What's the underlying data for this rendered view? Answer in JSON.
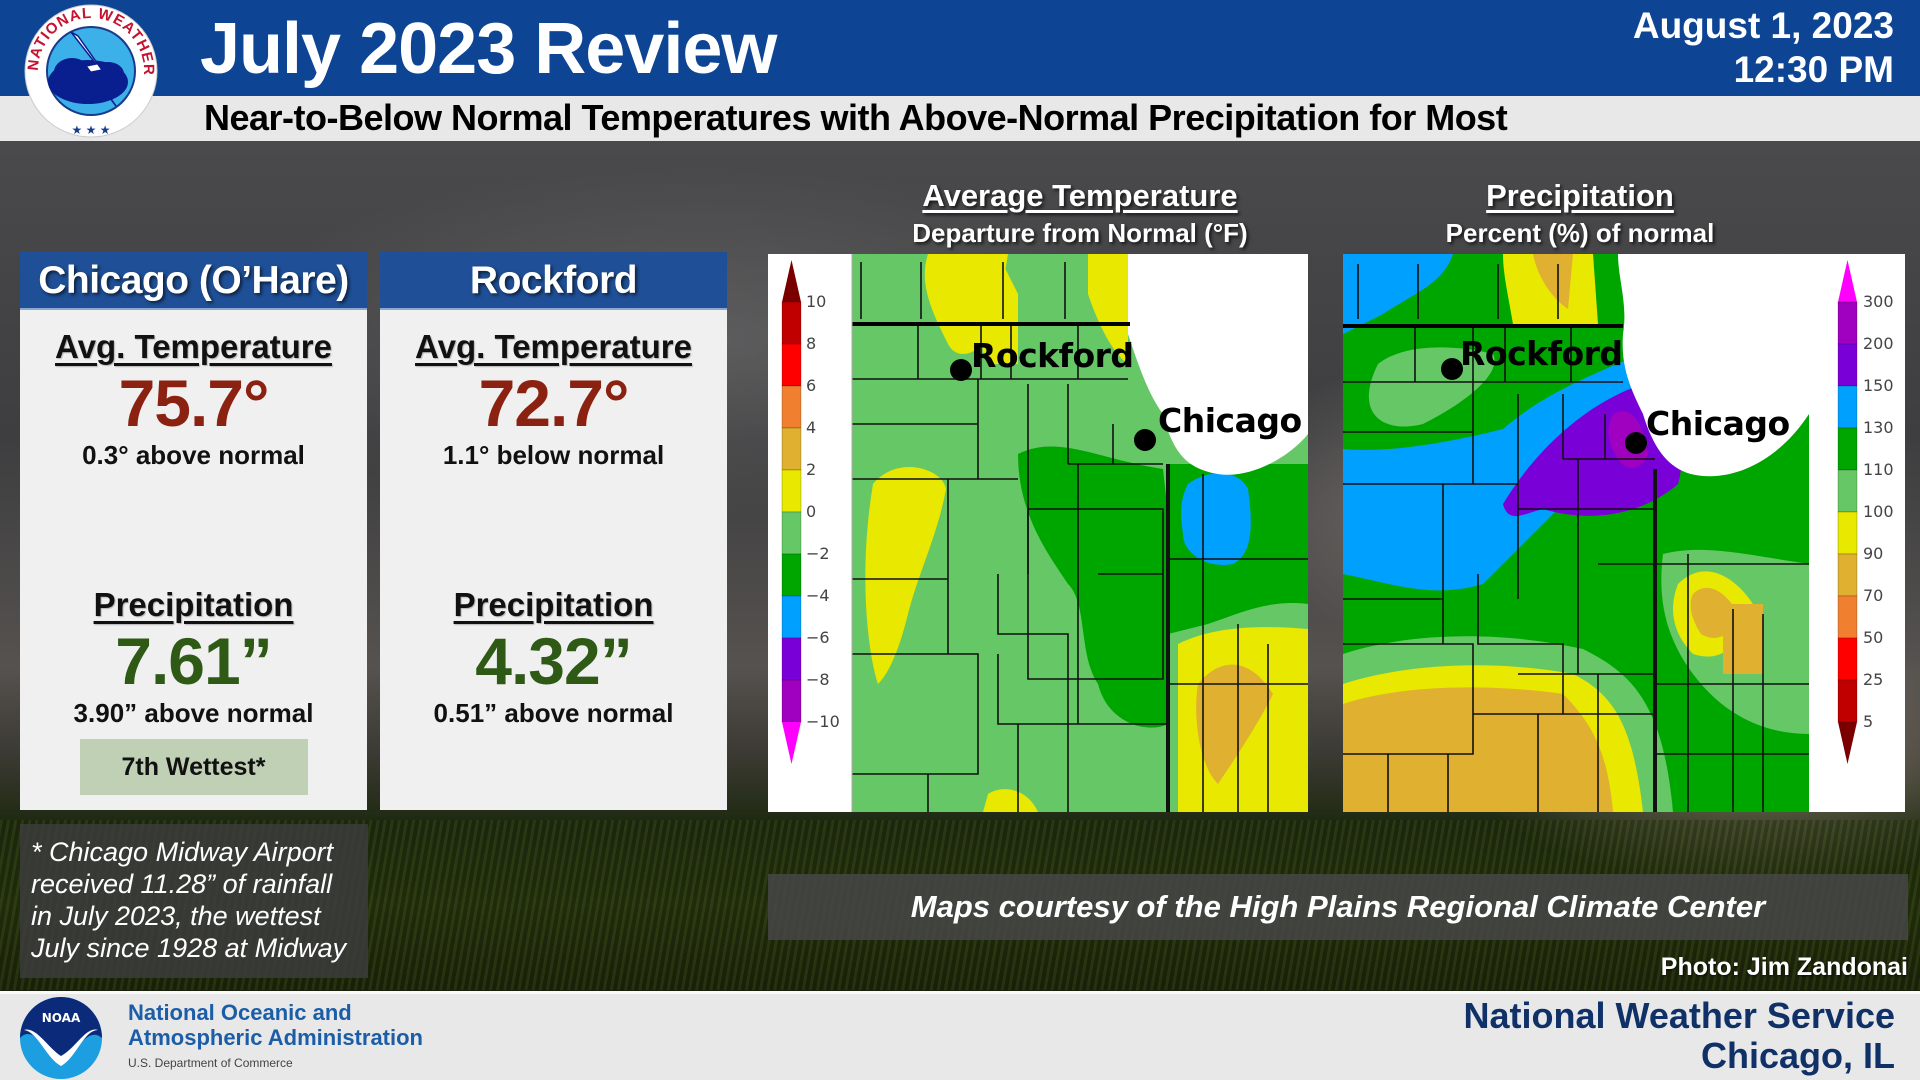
{
  "header": {
    "logo": "nws-logo",
    "logo_ring_text": "NATIONAL WEATHER SERVICE",
    "title": "July 2023 Review",
    "subtitle": "Near-to-Below Normal Temperatures with Above-Normal Precipitation for Most",
    "date": "August 1, 2023",
    "time": "12:30 PM",
    "colors": {
      "header_blue": "#0d4594",
      "subtitle_bg": "#e8e8e8"
    }
  },
  "stations": [
    {
      "name": "Chicago (O’Hare)",
      "temp_label": "Avg. Temperature",
      "avg_temp": "75.7°",
      "temp_departure": "0.3° above normal",
      "precip_label": "Precipitation",
      "precip_total": "7.61”",
      "precip_departure": "3.90” above normal",
      "rank_badge": "7th Wettest*"
    },
    {
      "name": "Rockford",
      "temp_label": "Avg. Temperature",
      "avg_temp": "72.7°",
      "temp_departure": "1.1° below normal",
      "precip_label": "Precipitation",
      "precip_total": "4.32”",
      "precip_departure": "0.51” above normal"
    }
  ],
  "footnote": {
    "lines": [
      "* Chicago Midway Airport",
      "received 11.28” of rainfall",
      "in July 2023, the wettest",
      "July since 1928 at Midway"
    ]
  },
  "maps": {
    "temperature": {
      "title": "Average Temperature",
      "subtitle": "Departure from Normal (°F)",
      "legend_ticks": [
        "10",
        "8",
        "6",
        "4",
        "2",
        "0",
        "−2",
        "−4",
        "−6",
        "−8",
        "−10"
      ],
      "legend_colors": [
        "#7a0000",
        "#c00000",
        "#ff0000",
        "#f08030",
        "#e0b030",
        "#e8e800",
        "#66c766",
        "#00a600",
        "#00a0ff",
        "#7a00d8",
        "#a000c0",
        "#ff00ff"
      ],
      "cities": [
        "Rockford",
        "Chicago"
      ]
    },
    "precipitation": {
      "title": "Precipitation",
      "subtitle": "Percent (%) of normal",
      "legend_ticks": [
        "300",
        "200",
        "150",
        "130",
        "110",
        "100",
        "90",
        "70",
        "50",
        "25",
        "5"
      ],
      "legend_colors": [
        "#ff00ff",
        "#a000c0",
        "#7a00d8",
        "#00a0ff",
        "#00a600",
        "#66c766",
        "#e8e800",
        "#e0b030",
        "#f08030",
        "#ff0000",
        "#c00000",
        "#7a0000"
      ],
      "cities": [
        "Rockford",
        "Chicago"
      ]
    },
    "courtesy": "Maps courtesy of the High Plains Regional Climate Center"
  },
  "photo_credit": "Photo: Jim Zandonai",
  "footer": {
    "noaa_logo_text": "NOAA",
    "noaa_line1": "National Oceanic and",
    "noaa_line2": "Atmospheric Administration",
    "noaa_dept": "U.S. Department of Commerce",
    "nws_line1": "National Weather Service",
    "nws_line2": "Chicago, IL"
  }
}
